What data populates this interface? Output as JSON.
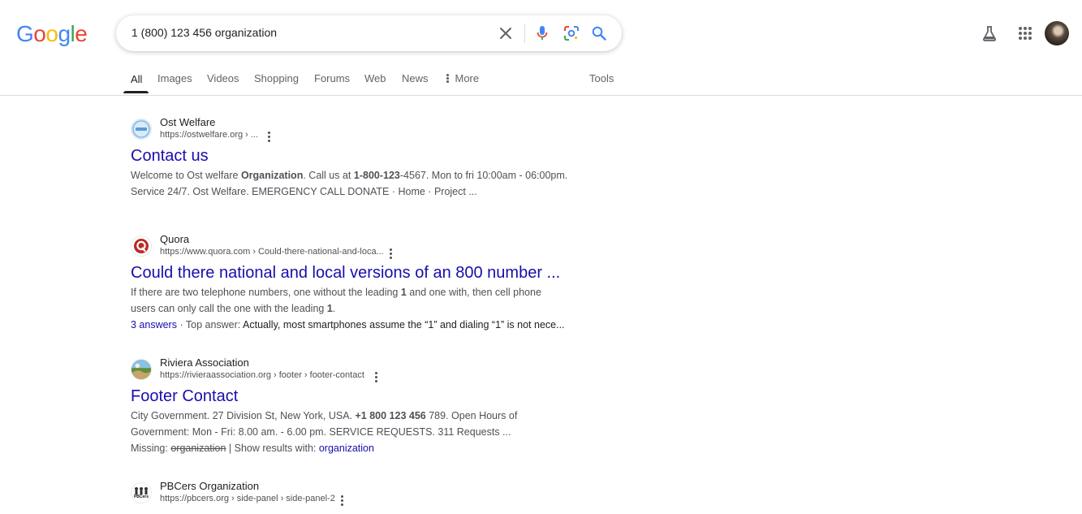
{
  "header": {
    "logo_letters": [
      {
        "ch": "G",
        "color": "#4285F4"
      },
      {
        "ch": "o",
        "color": "#EA4335"
      },
      {
        "ch": "o",
        "color": "#FBBC05"
      },
      {
        "ch": "g",
        "color": "#4285F4"
      },
      {
        "ch": "l",
        "color": "#34A853"
      },
      {
        "ch": "e",
        "color": "#EA4335"
      }
    ],
    "query": "1 (800) 123 456 organization"
  },
  "tabs": {
    "all": "All",
    "images": "Images",
    "videos": "Videos",
    "shopping": "Shopping",
    "forums": "Forums",
    "web": "Web",
    "news": "News",
    "more": "More",
    "tools": "Tools"
  },
  "results": {
    "r1": {
      "site": "Ost Welfare",
      "url": "https://ostwelfare.org › ...",
      "title": "Contact us",
      "line1_pre": "Welcome to Ost welfare ",
      "line1_b1": "Organization",
      "line1_mid": ". Call us at ",
      "line1_b2": "1-800-123",
      "line1_post": "-4567. Mon to fri 10:00am - 06:00pm.",
      "line2": "Service 24/7. Ost Welfare. EMERGENCY CALL DONATE · Home · Project ..."
    },
    "r2": {
      "site": "Quora",
      "url": "https://www.quora.com › Could-there-national-and-loca...",
      "title": "Could there national and local versions of an 800 number ...",
      "line1_pre": "If there are two telephone numbers, one without the leading ",
      "line1_b": "1",
      "line1_post": " and one with, then cell phone",
      "line2_pre": "users can only call the one with the leading ",
      "line2_b": "1",
      "line2_post": ".",
      "answers": "3 answers",
      "answer_sep": " · Top answer: ",
      "answer_text": "Actually, most smartphones assume the “1” and dialing “1” is not nece..."
    },
    "r3": {
      "site": "Riviera Association",
      "url": "https://rivieraassociation.org › footer › footer-contact",
      "title": "Footer Contact",
      "line1_pre": "City Government. 27 Division St, New York, USA. ",
      "line1_b": "+1 800 123 456",
      "line1_post": " 789. Open Hours of",
      "line2": "Government: Mon - Fri: 8.00 am. - 6.00 pm. SERVICE REQUESTS. 311 Requests ...",
      "missing_label": "Missing: ",
      "missing_word": "organization",
      "show_with": " | Show results with: ",
      "show_link": "organization"
    },
    "r4": {
      "site": "PBCers Organization",
      "url": "https://pbcers.org › side-panel › side-panel-2",
      "favicon_text": "PBCers"
    }
  },
  "icons": {
    "clear": "close-icon",
    "voice": "microphone-icon",
    "lens": "lens-icon",
    "search": "search-icon",
    "labs": "flask-icon",
    "apps": "apps-grid-icon",
    "more": "more-vert-icon"
  },
  "colors": {
    "link": "#1a0dab",
    "text": "#202124",
    "muted": "#4d5156",
    "tab": "#5f6368"
  }
}
